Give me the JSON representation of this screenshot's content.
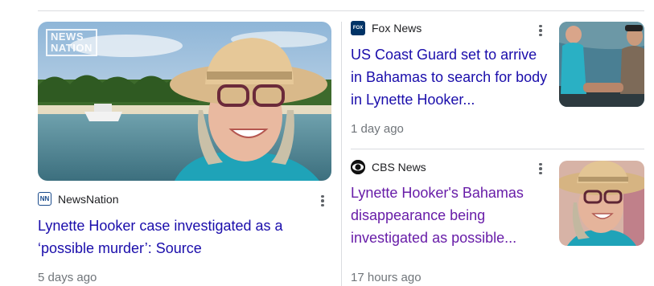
{
  "stories": [
    {
      "source": "NewsNation",
      "source_logo": "NN",
      "headline": "Lynette Hooker case investigated as a ‘possible murder’: Source",
      "time": "5 days ago",
      "watermark": [
        "NEWS",
        "NATION"
      ]
    },
    {
      "source": "Fox News",
      "source_logo": "FOX",
      "headline": "US Coast Guard set to arrive in Bahamas to search for body in Lynette Hooker...",
      "time": "1 day ago"
    },
    {
      "source": "CBS News",
      "source_logo": "CBS",
      "headline": "Lynette Hooker's Bahamas disappearance being investigated as possible...",
      "time": "17 hours ago"
    }
  ],
  "icons": {
    "more": "more-vert-icon"
  },
  "colors": {
    "link": "#1a0dab",
    "visited": "#681da8",
    "meta": "#70757a"
  }
}
